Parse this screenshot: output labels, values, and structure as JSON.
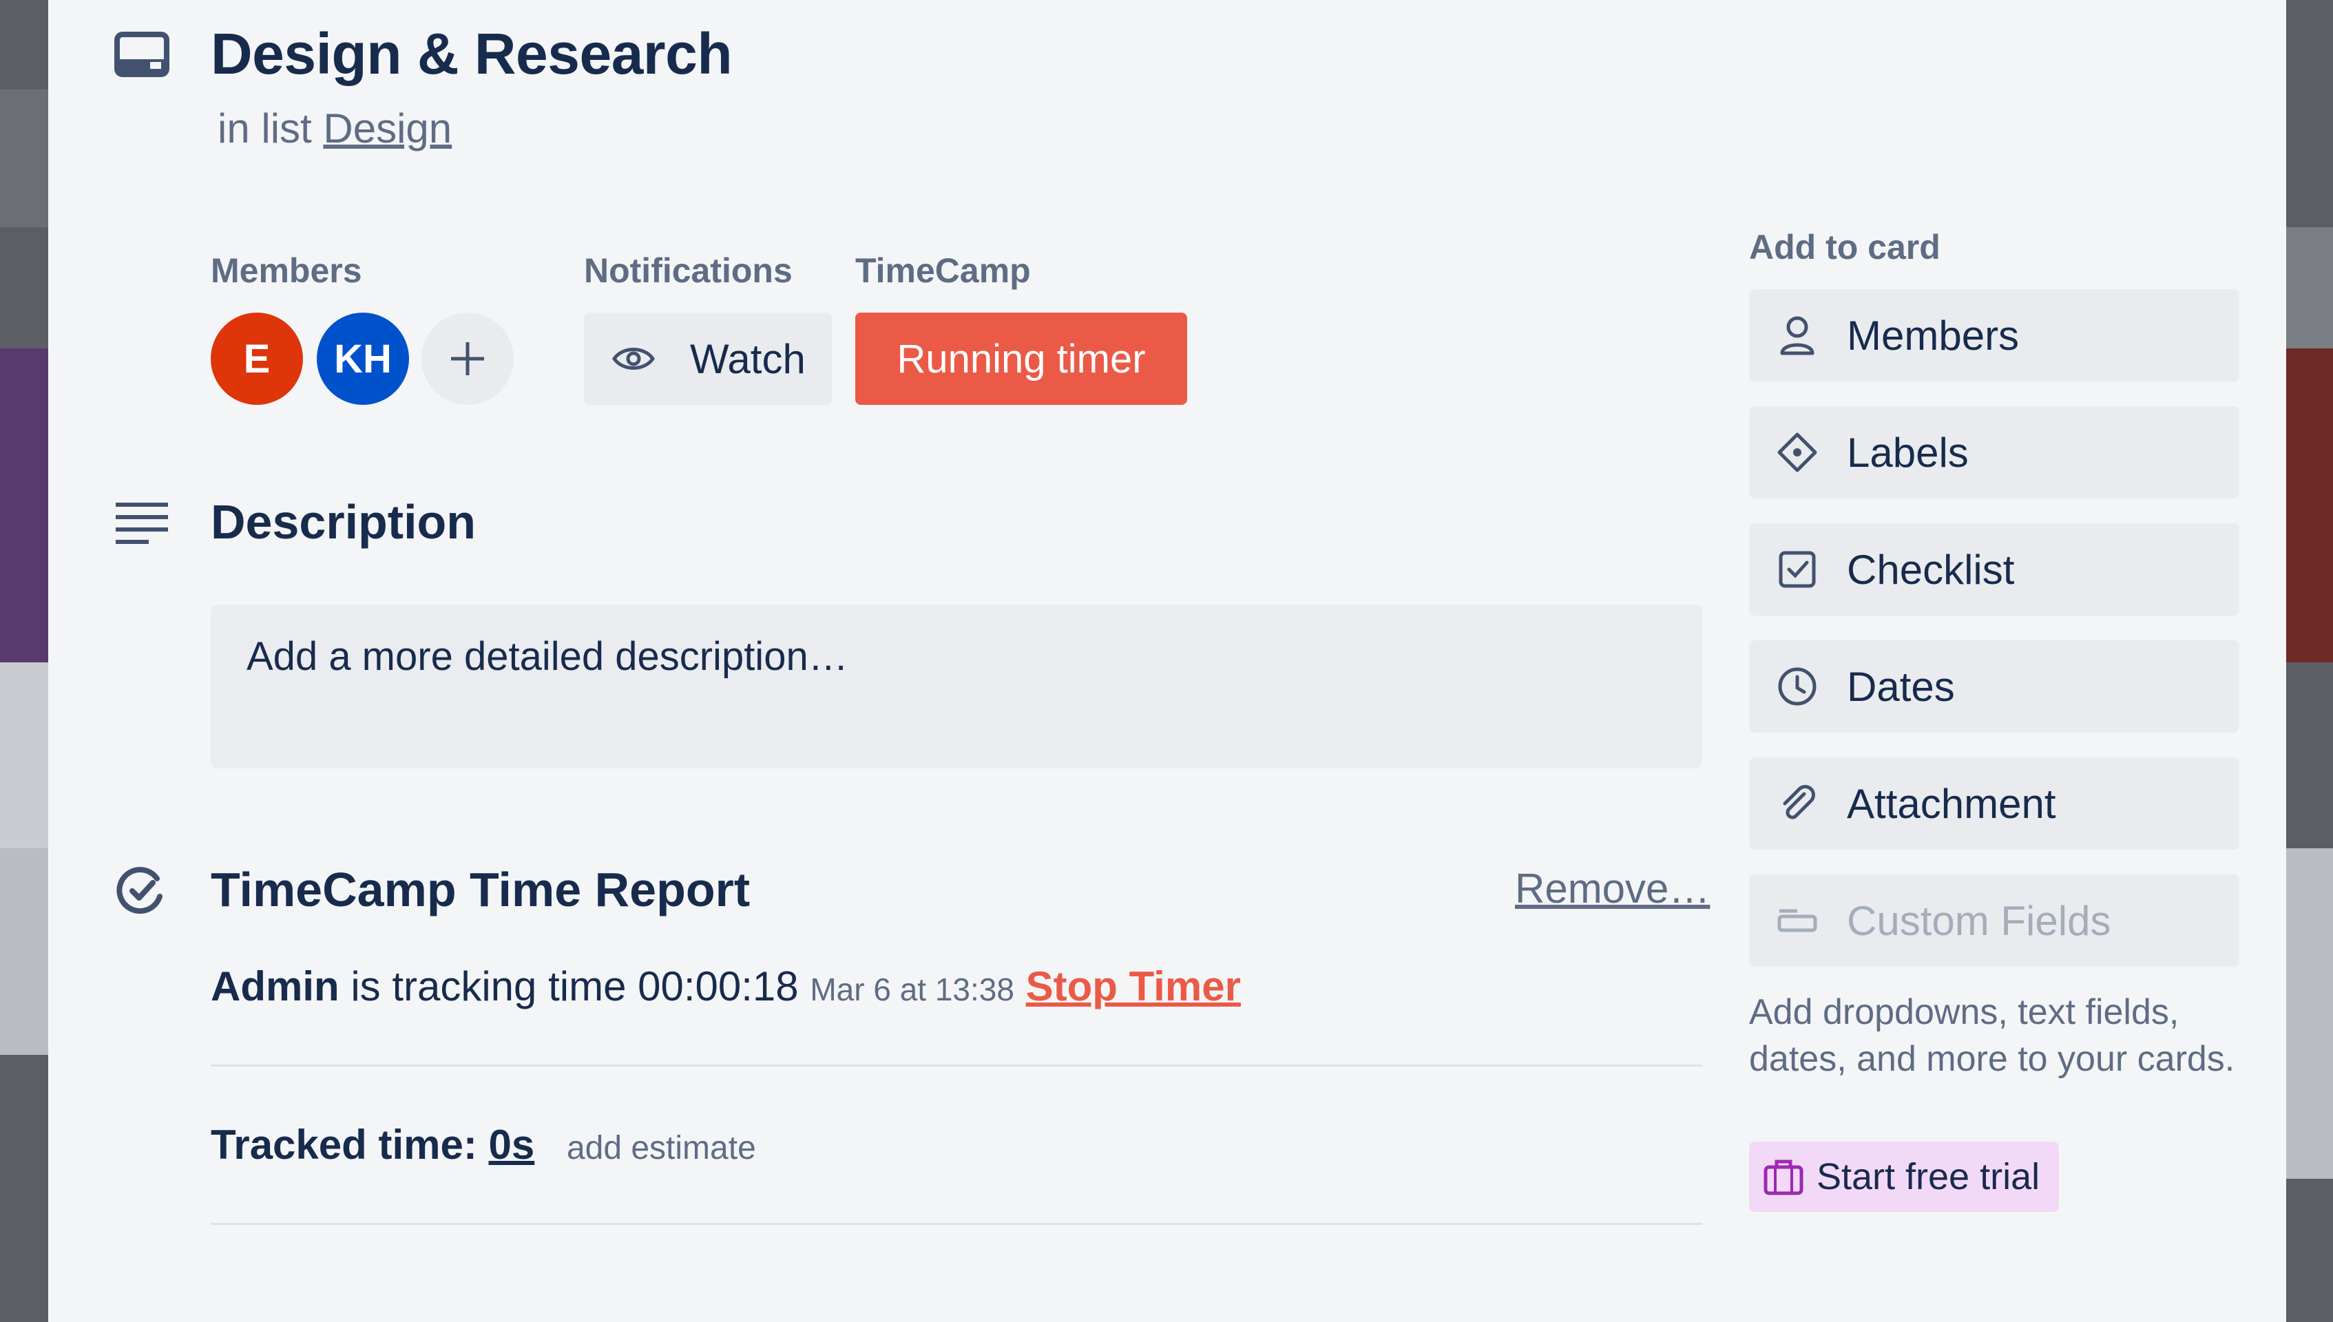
{
  "card": {
    "title": "Design & Research",
    "in_list_prefix": "in list",
    "list_name": "Design"
  },
  "members": {
    "label": "Members",
    "avatars": [
      {
        "initials": "E",
        "color": "#de350b"
      },
      {
        "initials": "KH",
        "color": "#0052cc"
      }
    ]
  },
  "notifications": {
    "label": "Notifications",
    "watch_label": "Watch"
  },
  "timecamp": {
    "label": "TimeCamp",
    "running_label": "Running timer",
    "accent": "#eb5a46"
  },
  "description": {
    "heading": "Description",
    "placeholder": "Add a more detailed description…"
  },
  "report": {
    "heading": "TimeCamp Time Report",
    "remove_label": "Remove…",
    "user": "Admin",
    "tracking_text": "is tracking time",
    "elapsed": "00:00:18",
    "started": "Mar 6 at 13:38",
    "stop_label": "Stop Timer",
    "tracked_label": "Tracked time:",
    "tracked_value": "0s",
    "estimate_label": "add estimate"
  },
  "sidebar": {
    "heading": "Add to card",
    "items": [
      {
        "label": "Members",
        "icon": "person-icon"
      },
      {
        "label": "Labels",
        "icon": "tag-icon"
      },
      {
        "label": "Checklist",
        "icon": "checkbox-icon"
      },
      {
        "label": "Dates",
        "icon": "clock-icon"
      },
      {
        "label": "Attachment",
        "icon": "paperclip-icon"
      },
      {
        "label": "Custom Fields",
        "icon": "field-icon"
      }
    ],
    "custom_fields_note": "Add dropdowns, text fields, dates, and more to your cards.",
    "trial_label": "Start free trial"
  }
}
